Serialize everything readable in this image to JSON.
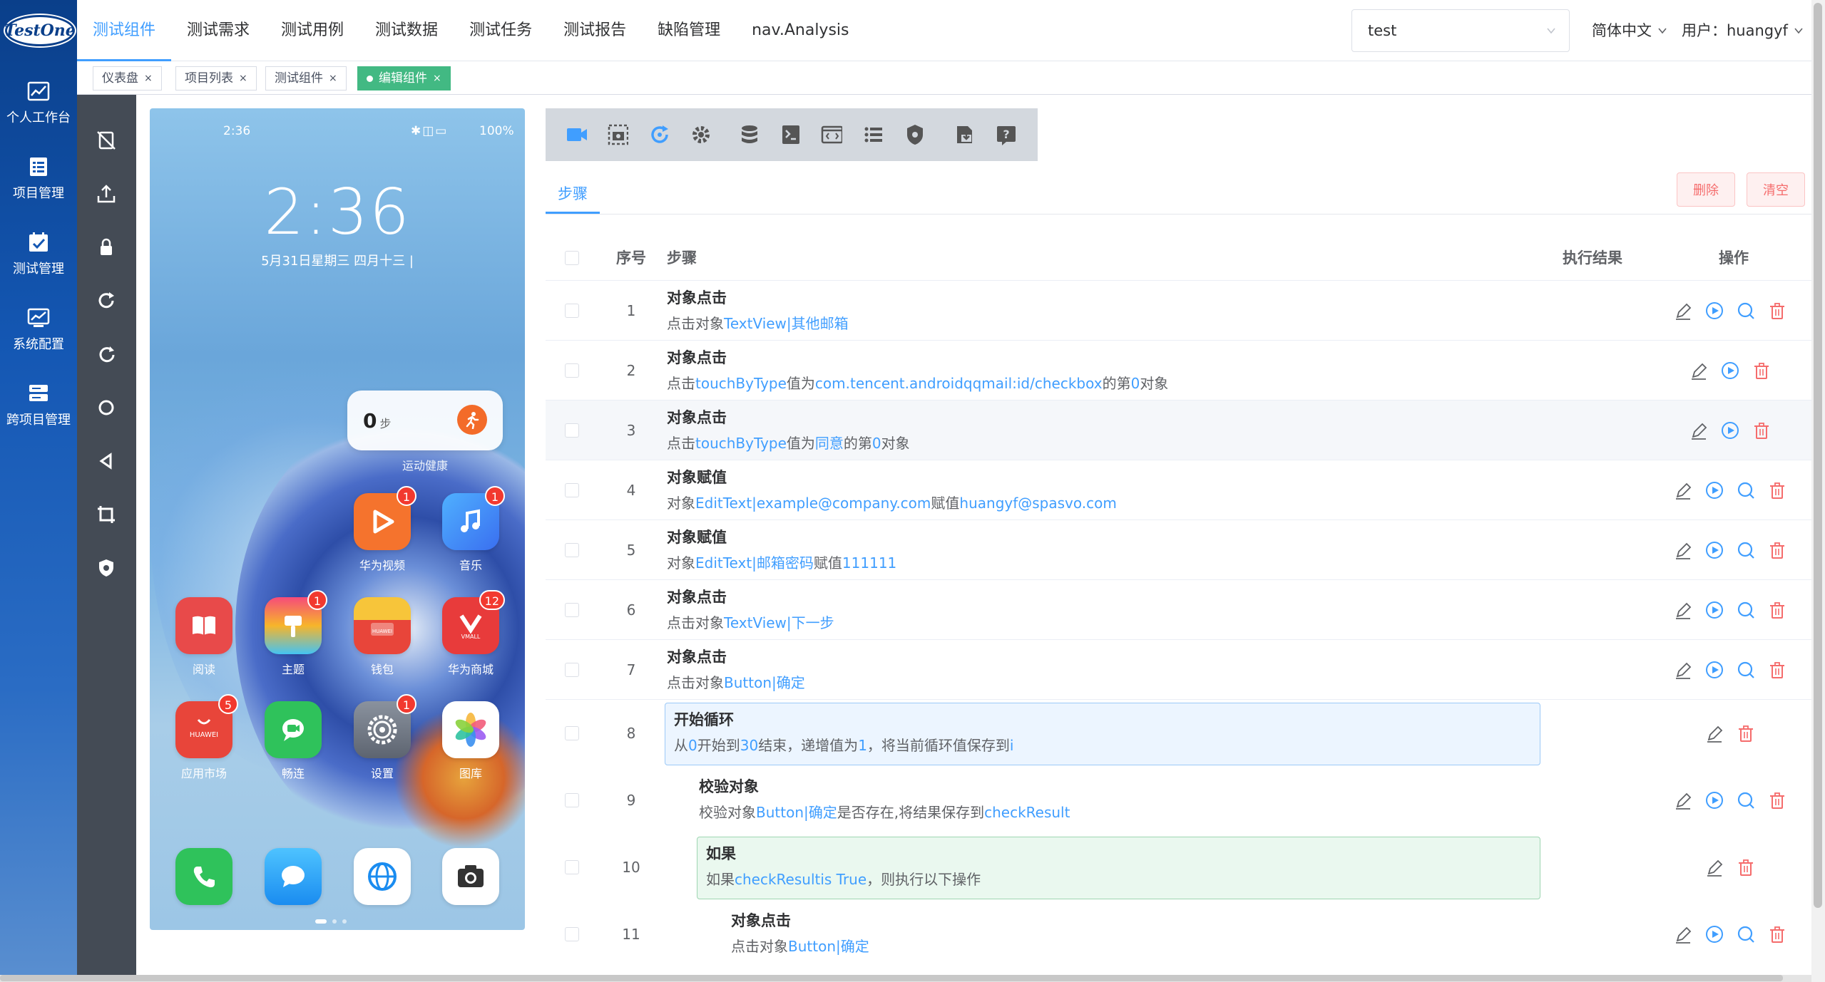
{
  "brand": {
    "logo_text": "TestOne"
  },
  "sidebar": {
    "items": [
      {
        "label": "个人工作台",
        "icon": "chart-icon"
      },
      {
        "label": "项目管理",
        "icon": "list-icon"
      },
      {
        "label": "测试管理",
        "icon": "calendar-check-icon"
      },
      {
        "label": "系统配置",
        "icon": "monitor-chart-icon"
      },
      {
        "label": "跨项目管理",
        "icon": "server-icon"
      }
    ]
  },
  "topnav": {
    "items": [
      "测试组件",
      "测试需求",
      "测试用例",
      "测试数据",
      "测试任务",
      "测试报告",
      "缺陷管理",
      "nav.Analysis"
    ],
    "active_index": 0,
    "project_select": "test",
    "language": "简体中文",
    "user": "用户：huangyf"
  },
  "tags": [
    {
      "label": "仪表盘",
      "close": "×"
    },
    {
      "label": "项目列表",
      "close": "×"
    },
    {
      "label": "测试组件",
      "close": "×"
    },
    {
      "label": "编辑组件",
      "close": "×",
      "active": true
    }
  ],
  "phone": {
    "status_time": "2:36",
    "status_battery": "100%",
    "clock": "2:36",
    "date": "5月31日星期三  四月十三  |",
    "widget_steps": "0",
    "widget_unit": "步",
    "widget_label": "运动健康",
    "apps": [
      {
        "label": "华为视频",
        "badge": "1",
        "color": "#f5732d"
      },
      {
        "label": "音乐",
        "badge": "1",
        "color": "#3a8ff0"
      },
      {
        "label": "阅读",
        "badge": "",
        "color": "#e84a4a"
      },
      {
        "label": "主题",
        "badge": "1",
        "color": "#f0a02a"
      },
      {
        "label": "钱包",
        "badge": "",
        "color": "#e84a3a"
      },
      {
        "label": "华为商城",
        "badge": "12",
        "color": "#e83b3b"
      },
      {
        "label": "应用市场",
        "badge": "5",
        "color": "#e8453a"
      },
      {
        "label": "畅连",
        "badge": "",
        "color": "#2fc25b"
      },
      {
        "label": "设置",
        "badge": "1",
        "color": "#6b7380"
      },
      {
        "label": "图库",
        "badge": "",
        "color": "#ffffff"
      }
    ],
    "dock": [
      "phone-app-icon",
      "messages-app-icon",
      "browser-app-icon",
      "camera-app-icon"
    ]
  },
  "toolbar": {
    "buttons": [
      "video-icon",
      "screenshot-icon",
      "refresh-target-icon",
      "gear-icon",
      "database-icon",
      "script-icon",
      "code-window-icon",
      "list-icon",
      "shield-icon",
      "import-icon",
      "help-icon"
    ]
  },
  "steps_tab": "步骤",
  "actions": {
    "delete": "删除",
    "clear": "清空"
  },
  "table": {
    "headers": {
      "seq": "序号",
      "step": "步骤",
      "result": "执行结果",
      "ops": "操作"
    },
    "rows": [
      {
        "seq": "1",
        "title": "对象点击",
        "desc": [
          {
            "t": "点击对象"
          },
          {
            "t": "TextView|其他邮箱",
            "b": true
          }
        ]
      },
      {
        "seq": "2",
        "title": "对象点击",
        "desc": [
          {
            "t": "点击"
          },
          {
            "t": "touchByType",
            "b": true
          },
          {
            "t": "值为"
          },
          {
            "t": "com.tencent.androidqqmail:id/checkbox",
            "b": true
          },
          {
            "t": "的第"
          },
          {
            "t": "0",
            "b": true
          },
          {
            "t": "对象"
          }
        ]
      },
      {
        "seq": "3",
        "title": "对象点击",
        "desc": [
          {
            "t": "点击"
          },
          {
            "t": "touchByType",
            "b": true
          },
          {
            "t": "值为"
          },
          {
            "t": "同意",
            "b": true
          },
          {
            "t": "的第"
          },
          {
            "t": "0",
            "b": true
          },
          {
            "t": "对象"
          }
        ]
      },
      {
        "seq": "4",
        "title": "对象赋值",
        "desc": [
          {
            "t": "对象"
          },
          {
            "t": "EditText|example@company.com",
            "b": true
          },
          {
            "t": "赋值"
          },
          {
            "t": "huangyf@spasvo.com",
            "b": true
          }
        ]
      },
      {
        "seq": "5",
        "title": "对象赋值",
        "desc": [
          {
            "t": "对象"
          },
          {
            "t": "EditText|邮箱密码",
            "b": true
          },
          {
            "t": "赋值"
          },
          {
            "t": "111111",
            "b": true
          }
        ]
      },
      {
        "seq": "6",
        "title": "对象点击",
        "desc": [
          {
            "t": "点击对象"
          },
          {
            "t": "TextView|下一步",
            "b": true
          }
        ]
      },
      {
        "seq": "7",
        "title": "对象点击",
        "desc": [
          {
            "t": "点击对象"
          },
          {
            "t": "Button|确定",
            "b": true
          }
        ]
      },
      {
        "seq": "8",
        "title": "开始循环",
        "desc": [
          {
            "t": "从"
          },
          {
            "t": "0",
            "b": true
          },
          {
            "t": "开始到"
          },
          {
            "t": "30",
            "b": true
          },
          {
            "t": "结束，递增值为"
          },
          {
            "t": "1",
            "b": true
          },
          {
            "t": "，将当前循环值保存到"
          },
          {
            "t": "i",
            "b": true
          }
        ]
      },
      {
        "seq": "9",
        "title": "校验对象",
        "desc": [
          {
            "t": "校验对象"
          },
          {
            "t": "Button|确定",
            "b": true
          },
          {
            "t": "是否存在,将结果保存到"
          },
          {
            "t": "checkResult",
            "b": true
          }
        ]
      },
      {
        "seq": "10",
        "title": "如果",
        "desc": [
          {
            "t": "如果"
          },
          {
            "t": "checkResultis True",
            "b": true
          },
          {
            "t": "，则执行以下操作"
          }
        ]
      },
      {
        "seq": "11",
        "title": "对象点击",
        "desc": [
          {
            "t": "点击对象"
          },
          {
            "t": "Button|确定",
            "b": true
          }
        ]
      }
    ]
  }
}
